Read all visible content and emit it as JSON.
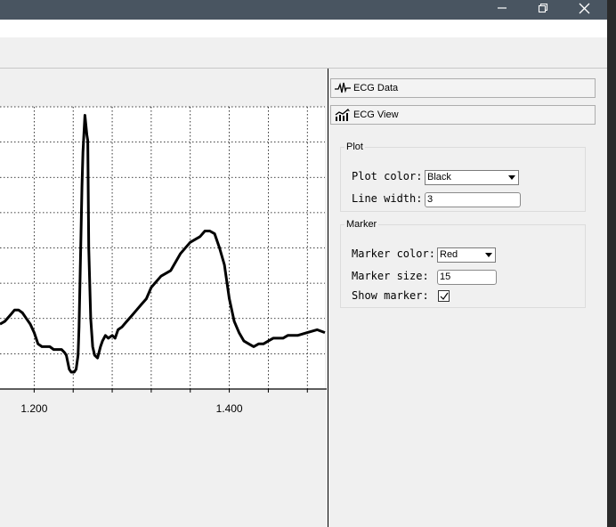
{
  "window": {
    "controls": {
      "minimize": "—",
      "maximize": "⧉",
      "close": "✕"
    }
  },
  "panel": {
    "buttons": [
      {
        "label": "ECG Data",
        "icon": "waveform-icon"
      },
      {
        "label": "ECG View",
        "icon": "chart-icon"
      }
    ],
    "plot_group": {
      "title": "Plot",
      "plot_color_label": "Plot color:",
      "plot_color_value": "Black",
      "line_width_label": "Line width:",
      "line_width_value": "3"
    },
    "marker_group": {
      "title": "Marker",
      "marker_color_label": "Marker color:",
      "marker_color_value": "Red",
      "marker_size_label": "Marker size:",
      "marker_size_value": "15",
      "show_marker_label": "Show marker:",
      "show_marker_checked": true
    }
  },
  "chart_data": {
    "type": "line",
    "x_tick_labels": [
      "1.200",
      "1.400"
    ],
    "x_ticks": [
      1.2,
      1.4
    ],
    "xlim": [
      1.165,
      1.498
    ],
    "ylim": [
      0,
      1
    ],
    "grid": true,
    "line_color": "#000000",
    "line_width": 3,
    "series": [
      {
        "x": [
          1.165,
          1.17,
          1.175,
          1.18,
          1.184,
          1.188,
          1.192,
          1.196,
          1.2,
          1.204,
          1.208,
          1.212,
          1.216,
          1.22,
          1.225,
          1.228,
          1.231,
          1.233,
          1.236,
          1.238,
          1.241,
          1.243,
          1.245,
          1.246,
          1.248,
          1.249,
          1.25,
          1.252,
          1.254,
          1.255,
          1.256,
          1.258,
          1.26,
          1.262,
          1.265,
          1.268,
          1.27,
          1.273,
          1.276,
          1.28,
          1.283,
          1.286,
          1.29,
          1.295,
          1.3,
          1.305,
          1.31,
          1.315,
          1.32,
          1.33,
          1.34,
          1.35,
          1.36,
          1.37,
          1.375,
          1.38,
          1.385,
          1.39,
          1.395,
          1.4,
          1.405,
          1.41,
          1.415,
          1.42,
          1.425,
          1.43,
          1.435,
          1.44,
          1.445,
          1.45,
          1.455,
          1.46,
          1.47,
          1.48,
          1.49,
          1.498
        ],
        "y": [
          0.23,
          0.24,
          0.26,
          0.28,
          0.28,
          0.27,
          0.25,
          0.23,
          0.2,
          0.16,
          0.15,
          0.15,
          0.15,
          0.14,
          0.14,
          0.14,
          0.13,
          0.12,
          0.07,
          0.06,
          0.06,
          0.07,
          0.12,
          0.22,
          0.55,
          0.72,
          0.84,
          0.97,
          0.9,
          0.88,
          0.5,
          0.25,
          0.15,
          0.12,
          0.11,
          0.15,
          0.17,
          0.19,
          0.18,
          0.19,
          0.18,
          0.21,
          0.22,
          0.24,
          0.26,
          0.28,
          0.3,
          0.32,
          0.36,
          0.4,
          0.42,
          0.48,
          0.52,
          0.54,
          0.56,
          0.56,
          0.55,
          0.5,
          0.44,
          0.32,
          0.24,
          0.2,
          0.17,
          0.16,
          0.15,
          0.16,
          0.16,
          0.17,
          0.18,
          0.18,
          0.18,
          0.19,
          0.19,
          0.2,
          0.21,
          0.2
        ]
      }
    ]
  }
}
